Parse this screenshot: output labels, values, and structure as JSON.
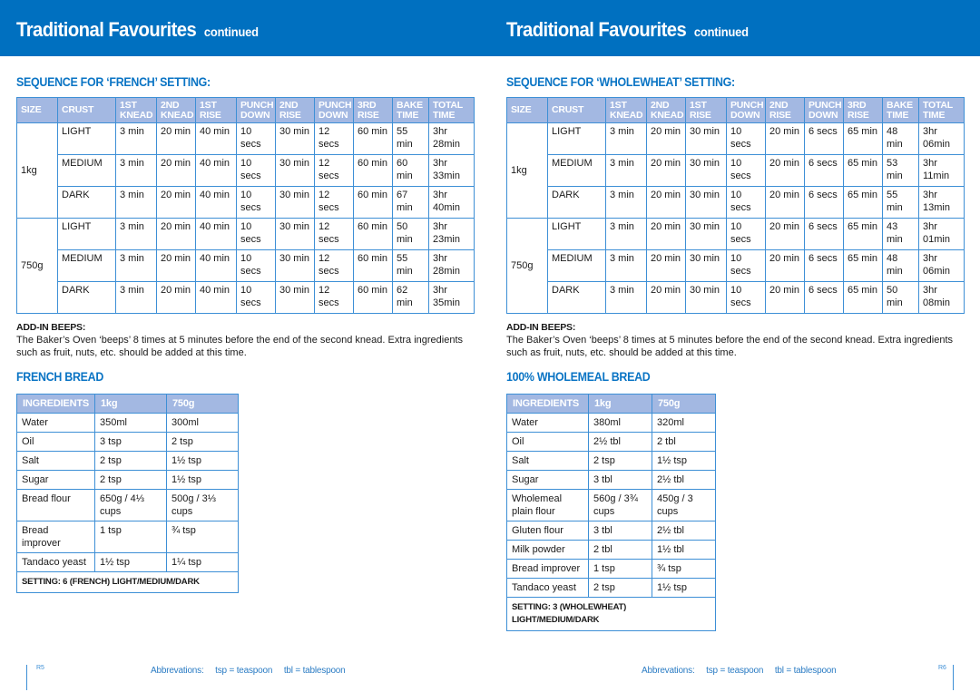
{
  "left_page": {
    "title": "Traditional Favourites",
    "title_suffix": "continued",
    "sequence_heading": "SEQUENCE FOR ‘FRENCH’ SETTING:",
    "sequence_table": {
      "headers": [
        [
          "SIZE",
          ""
        ],
        [
          "CRUST",
          ""
        ],
        [
          "1ST",
          "KNEAD"
        ],
        [
          "2ND",
          "KNEAD"
        ],
        [
          "1ST",
          "RISE"
        ],
        [
          "PUNCH",
          "DOWN"
        ],
        [
          "2ND",
          "RISE"
        ],
        [
          "PUNCH",
          "DOWN"
        ],
        [
          "3RD",
          "RISE"
        ],
        [
          "BAKE",
          "TIME"
        ],
        [
          "TOTAL",
          "TIME"
        ]
      ],
      "groups": [
        {
          "size": "1kg",
          "rows": [
            [
              "LIGHT",
              "3 min",
              "20 min",
              "40 min",
              "10 secs",
              "30 min",
              "12 secs",
              "60 min",
              "55 min",
              "3hr 28min"
            ],
            [
              "MEDIUM",
              "3 min",
              "20 min",
              "40 min",
              "10 secs",
              "30 min",
              "12 secs",
              "60 min",
              "60 min",
              "3hr 33min"
            ],
            [
              "DARK",
              "3 min",
              "20 min",
              "40 min",
              "10 secs",
              "30 min",
              "12 secs",
              "60 min",
              "67 min",
              "3hr 40min"
            ]
          ]
        },
        {
          "size": "750g",
          "rows": [
            [
              "LIGHT",
              "3 min",
              "20 min",
              "40 min",
              "10 secs",
              "30 min",
              "12 secs",
              "60 min",
              "50 min",
              "3hr 23min"
            ],
            [
              "MEDIUM",
              "3 min",
              "20 min",
              "40 min",
              "10 secs",
              "30 min",
              "12 secs",
              "60 min",
              "55 min",
              "3hr 28min"
            ],
            [
              "DARK",
              "3 min",
              "20 min",
              "40 min",
              "10 secs",
              "30 min",
              "12 secs",
              "60 min",
              "62 min",
              "3hr 35min"
            ]
          ]
        }
      ]
    },
    "addin_title": "ADD-IN BEEPS:",
    "addin_body": "The Baker’s Oven ‘beeps’ 8 times at 5 minutes before the end of the second knead. Extra ingredients such as fruit, nuts, etc. should be added at this time.",
    "recipe_heading": "FRENCH BREAD",
    "ingredients_table": {
      "headers": [
        "INGREDIENTS",
        "1kg",
        "750g"
      ],
      "rows": [
        [
          "Water",
          "350ml",
          "300ml"
        ],
        [
          "Oil",
          "3 tsp",
          "2 tsp"
        ],
        [
          "Salt",
          "2 tsp",
          "1½ tsp"
        ],
        [
          "Sugar",
          "2 tsp",
          "1½ tsp"
        ],
        [
          "Bread flour",
          "650g / 4⅓ cups",
          "500g / 3⅓ cups"
        ],
        [
          "Bread improver",
          "1 tsp",
          "¾ tsp"
        ],
        [
          "Tandaco yeast",
          "1½ tsp",
          "1¼ tsp"
        ]
      ],
      "setting": "SETTING: 6 (FRENCH) LIGHT/MEDIUM/DARK"
    },
    "page_number": "R5",
    "abbreviations": [
      "Abbrevations:",
      "tsp = teaspoon",
      "tbl = tablespoon"
    ]
  },
  "right_page": {
    "title": "Traditional Favourites",
    "title_suffix": "continued",
    "sequence_heading": "SEQUENCE FOR ‘WHOLEWHEAT’ SETTING:",
    "sequence_table": {
      "headers": [
        [
          "SIZE",
          ""
        ],
        [
          "CRUST",
          ""
        ],
        [
          "1ST",
          "KNEAD"
        ],
        [
          "2ND",
          "KNEAD"
        ],
        [
          "1ST",
          "RISE"
        ],
        [
          "PUNCH",
          "DOWN"
        ],
        [
          "2ND",
          "RISE"
        ],
        [
          "PUNCH",
          "DOWN"
        ],
        [
          "3RD",
          "RISE"
        ],
        [
          "BAKE",
          "TIME"
        ],
        [
          "TOTAL",
          "TIME"
        ]
      ],
      "groups": [
        {
          "size": "1kg",
          "rows": [
            [
              "LIGHT",
              "3 min",
              "20 min",
              "30 min",
              "10 secs",
              "20 min",
              "6 secs",
              "65 min",
              "48 min",
              "3hr 06min"
            ],
            [
              "MEDIUM",
              "3 min",
              "20 min",
              "30 min",
              "10 secs",
              "20 min",
              "6 secs",
              "65 min",
              "53 min",
              "3hr 11min"
            ],
            [
              "DARK",
              "3 min",
              "20 min",
              "30 min",
              "10 secs",
              "20 min",
              "6 secs",
              "65 min",
              "55 min",
              "3hr 13min"
            ]
          ]
        },
        {
          "size": "750g",
          "rows": [
            [
              "LIGHT",
              "3 min",
              "20 min",
              "30 min",
              "10 secs",
              "20 min",
              "6 secs",
              "65 min",
              "43 min",
              "3hr 01min"
            ],
            [
              "MEDIUM",
              "3 min",
              "20 min",
              "30 min",
              "10 secs",
              "20 min",
              "6 secs",
              "65 min",
              "48 min",
              "3hr 06min"
            ],
            [
              "DARK",
              "3 min",
              "20 min",
              "30 min",
              "10 secs",
              "20 min",
              "6 secs",
              "65 min",
              "50 min",
              "3hr 08min"
            ]
          ]
        }
      ]
    },
    "addin_title": "ADD-IN BEEPS:",
    "addin_body": "The Baker’s Oven ‘beeps’ 8 times at 5 minutes before the end of the second knead. Extra ingredients such as fruit, nuts, etc. should be added at this time.",
    "recipe_heading": "100% WHOLEMEAL BREAD",
    "ingredients_table": {
      "headers": [
        "INGREDIENTS",
        "1kg",
        "750g"
      ],
      "rows": [
        [
          "Water",
          "380ml",
          "320ml"
        ],
        [
          "Oil",
          "2½ tbl",
          "2 tbl"
        ],
        [
          "Salt",
          "2 tsp",
          "1½ tsp"
        ],
        [
          "Sugar",
          "3 tbl",
          "2½ tbl"
        ],
        [
          "Wholemeal plain flour",
          "560g / 3¾ cups",
          "450g / 3 cups"
        ],
        [
          "Gluten flour",
          "3 tbl",
          "2½ tbl"
        ],
        [
          "Milk powder",
          "2 tbl",
          "1½ tbl"
        ],
        [
          "Bread improver",
          "1 tsp",
          "¾ tsp"
        ],
        [
          "Tandaco yeast",
          "2 tsp",
          "1½ tsp"
        ]
      ],
      "setting": "SETTING: 3 (WHOLEWHEAT) LIGHT/MEDIUM/DARK"
    },
    "page_number": "R6",
    "abbreviations": [
      "Abbrevations:",
      "tsp = teaspoon",
      "tbl = tablespoon"
    ]
  },
  "colors": {
    "brand_blue": "#0070c0",
    "heading_blue": "#0a74c4",
    "table_header": "#a3b8e2",
    "table_border": "#3d8fd6"
  }
}
